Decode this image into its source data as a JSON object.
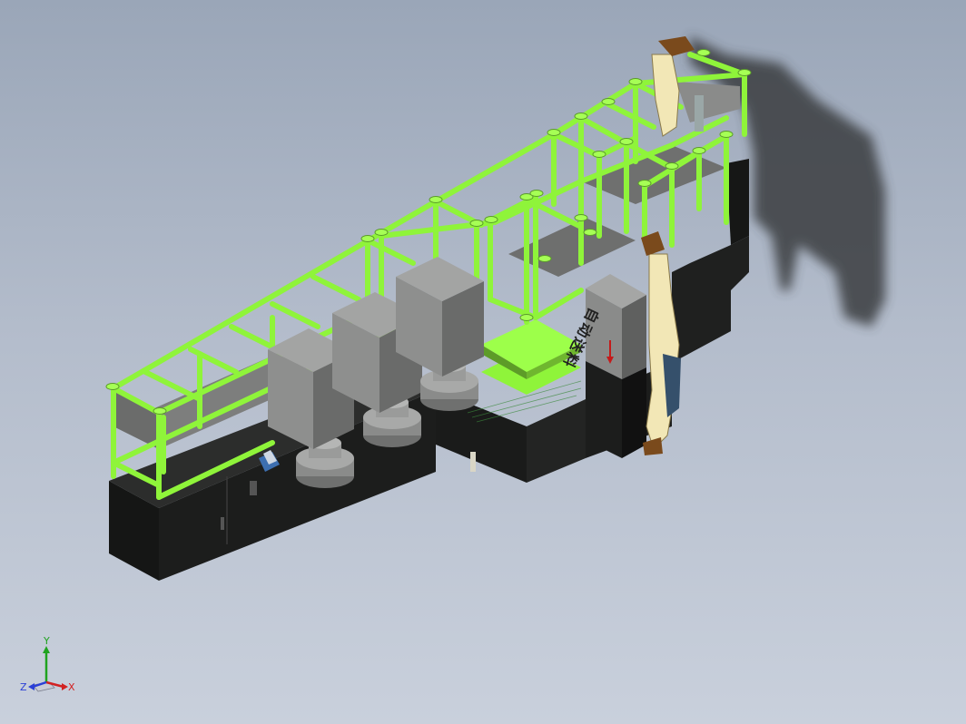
{
  "signage": {
    "vertical_label": "自动送料",
    "arrow_icon": "arrow-down-icon"
  },
  "triad": {
    "x_label": "X",
    "y_label": "Y",
    "z_label": "Z",
    "x_color": "#d22222",
    "y_color": "#1fa31f",
    "z_color": "#2a3fd6"
  },
  "colors": {
    "frame": "#8ff43a",
    "base": "#1c1d1c",
    "housing": "#7c7d7c",
    "shadow": "#3b3d41",
    "figure": "#f2e7b6"
  }
}
